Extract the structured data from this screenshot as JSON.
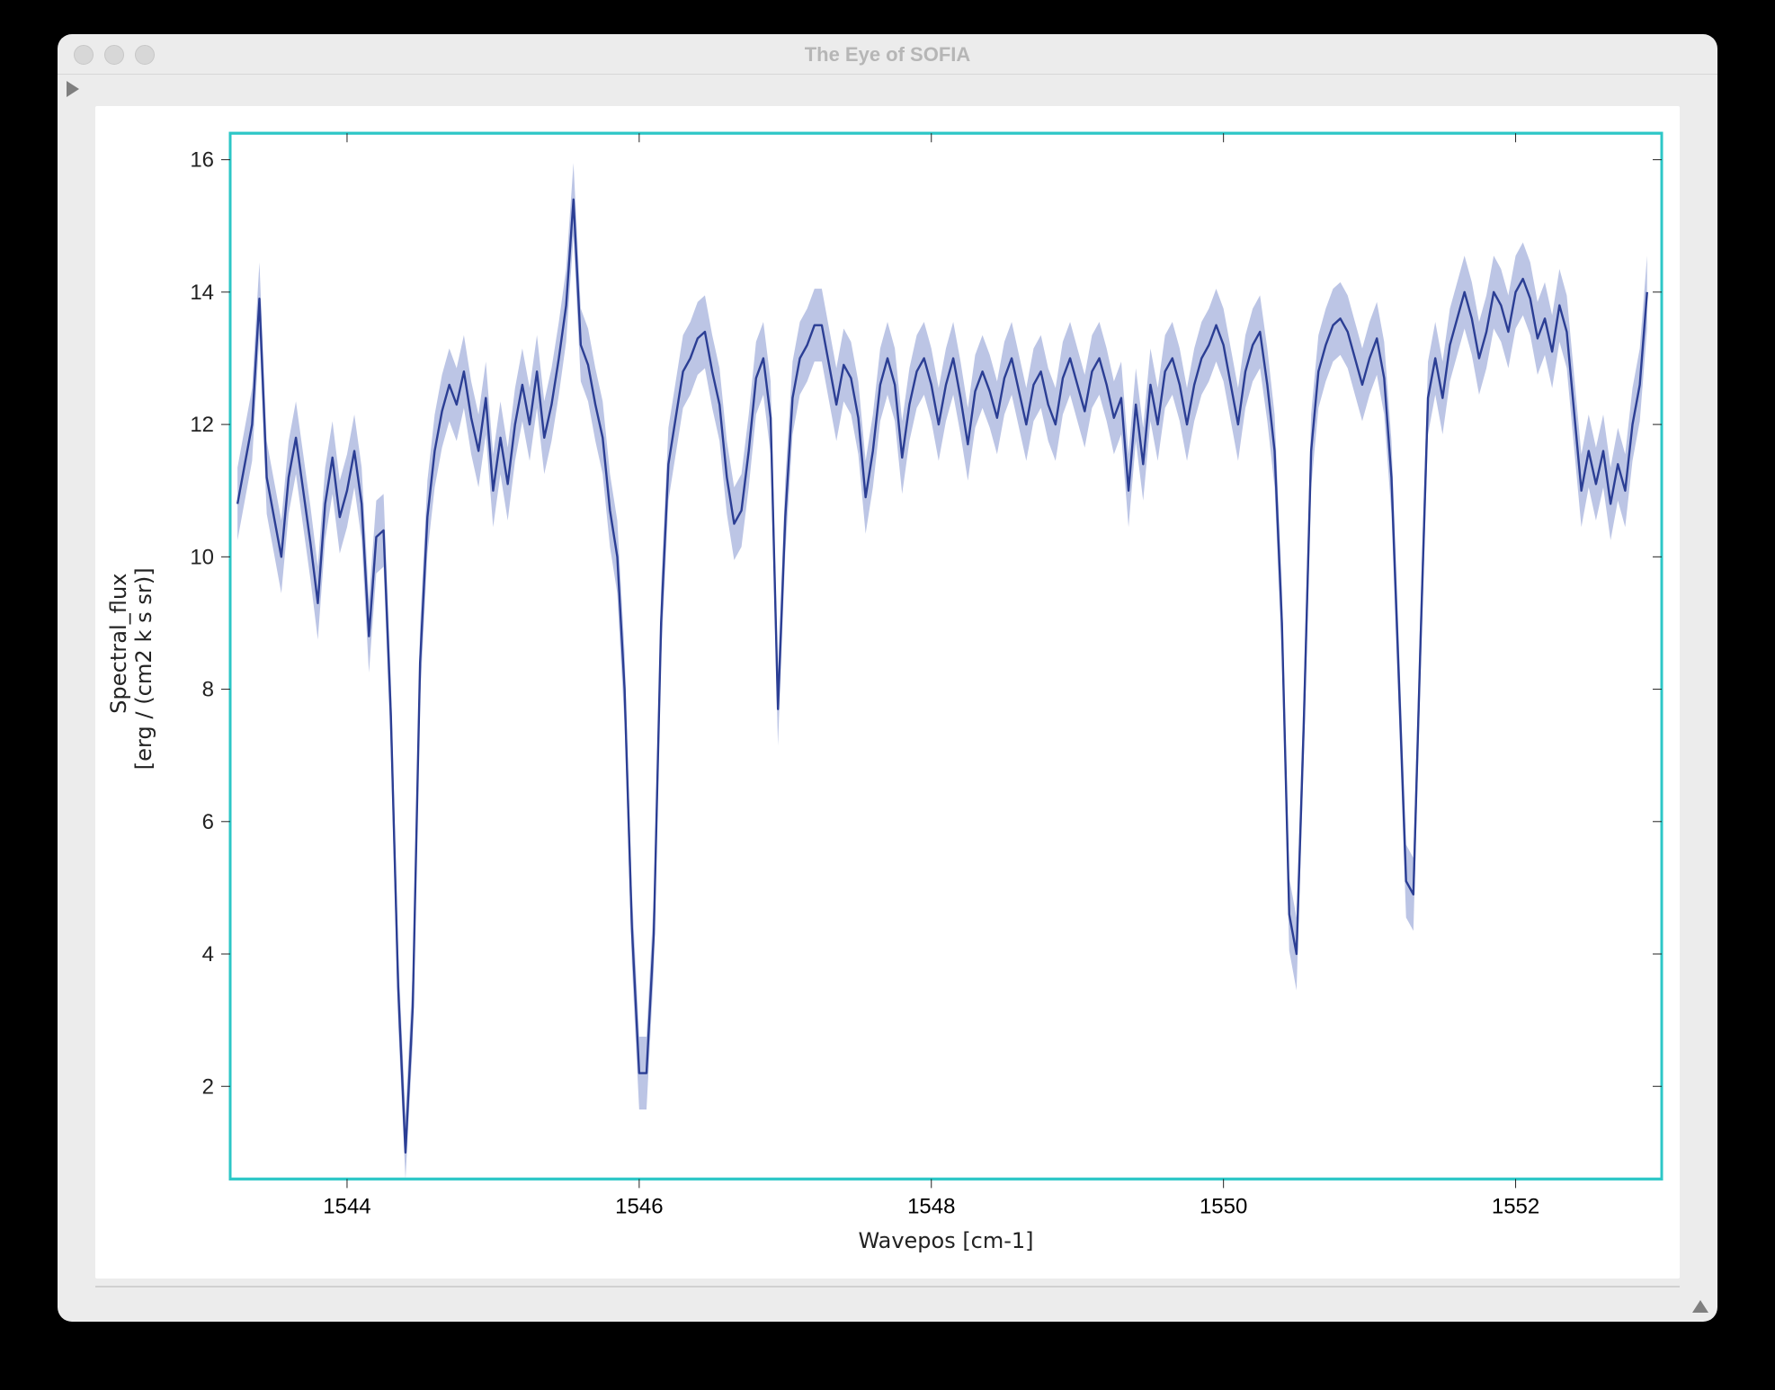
{
  "window": {
    "title": "The Eye of SOFIA"
  },
  "chart_data": {
    "type": "line",
    "title": "",
    "xlabel": "Wavepos [cm-1]",
    "ylabel_line1": "Spectral_flux",
    "ylabel_line2": "[erg / (cm2 k s sr)]",
    "xlim": [
      1543.2,
      1553.0
    ],
    "ylim": [
      0.6,
      16.4
    ],
    "xticks": [
      1544,
      1546,
      1548,
      1550,
      1552
    ],
    "yticks": [
      2,
      4,
      6,
      8,
      10,
      12,
      14,
      16
    ],
    "frame_color": "#2dc7c7",
    "series": [
      {
        "name": "spectrum",
        "color": "#2b3e94",
        "x": [
          1543.25,
          1543.3,
          1543.35,
          1543.4,
          1543.45,
          1543.5,
          1543.55,
          1543.6,
          1543.65,
          1543.7,
          1543.75,
          1543.8,
          1543.85,
          1543.9,
          1543.95,
          1544.0,
          1544.05,
          1544.1,
          1544.15,
          1544.2,
          1544.25,
          1544.3,
          1544.35,
          1544.4,
          1544.45,
          1544.5,
          1544.55,
          1544.6,
          1544.65,
          1544.7,
          1544.75,
          1544.8,
          1544.85,
          1544.9,
          1544.95,
          1545.0,
          1545.05,
          1545.1,
          1545.15,
          1545.2,
          1545.25,
          1545.3,
          1545.35,
          1545.4,
          1545.45,
          1545.5,
          1545.55,
          1545.6,
          1545.65,
          1545.7,
          1545.75,
          1545.8,
          1545.85,
          1545.9,
          1545.95,
          1546.0,
          1546.05,
          1546.1,
          1546.15,
          1546.2,
          1546.25,
          1546.3,
          1546.35,
          1546.4,
          1546.45,
          1546.5,
          1546.55,
          1546.6,
          1546.65,
          1546.7,
          1546.75,
          1546.8,
          1546.85,
          1546.9,
          1546.95,
          1547.0,
          1547.05,
          1547.1,
          1547.15,
          1547.2,
          1547.25,
          1547.3,
          1547.35,
          1547.4,
          1547.45,
          1547.5,
          1547.55,
          1547.6,
          1547.65,
          1547.7,
          1547.75,
          1547.8,
          1547.85,
          1547.9,
          1547.95,
          1548.0,
          1548.05,
          1548.1,
          1548.15,
          1548.2,
          1548.25,
          1548.3,
          1548.35,
          1548.4,
          1548.45,
          1548.5,
          1548.55,
          1548.6,
          1548.65,
          1548.7,
          1548.75,
          1548.8,
          1548.85,
          1548.9,
          1548.95,
          1549.0,
          1549.05,
          1549.1,
          1549.15,
          1549.2,
          1549.25,
          1549.3,
          1549.35,
          1549.4,
          1549.45,
          1549.5,
          1549.55,
          1549.6,
          1549.65,
          1549.7,
          1549.75,
          1549.8,
          1549.85,
          1549.9,
          1549.95,
          1550.0,
          1550.05,
          1550.1,
          1550.15,
          1550.2,
          1550.25,
          1550.3,
          1550.35,
          1550.4,
          1550.45,
          1550.5,
          1550.55,
          1550.6,
          1550.65,
          1550.7,
          1550.75,
          1550.8,
          1550.85,
          1550.9,
          1550.95,
          1551.0,
          1551.05,
          1551.1,
          1551.15,
          1551.2,
          1551.25,
          1551.3,
          1551.35,
          1551.4,
          1551.45,
          1551.5,
          1551.55,
          1551.6,
          1551.65,
          1551.7,
          1551.75,
          1551.8,
          1551.85,
          1551.9,
          1551.95,
          1552.0,
          1552.05,
          1552.1,
          1552.15,
          1552.2,
          1552.25,
          1552.3,
          1552.35,
          1552.4,
          1552.45,
          1552.5,
          1552.55,
          1552.6,
          1552.65,
          1552.7,
          1552.75,
          1552.8,
          1552.85,
          1552.9
        ],
        "y": [
          10.8,
          11.4,
          12.0,
          13.9,
          11.2,
          10.6,
          10.0,
          11.2,
          11.8,
          11.0,
          10.2,
          9.3,
          10.8,
          11.5,
          10.6,
          11.0,
          11.6,
          10.8,
          8.8,
          10.3,
          10.4,
          7.6,
          3.5,
          1.0,
          3.2,
          8.4,
          10.6,
          11.6,
          12.2,
          12.6,
          12.3,
          12.8,
          12.1,
          11.6,
          12.4,
          11.0,
          11.8,
          11.1,
          12.0,
          12.6,
          12.0,
          12.8,
          11.8,
          12.3,
          13.0,
          13.8,
          15.4,
          13.2,
          12.9,
          12.3,
          11.8,
          10.7,
          10.0,
          8.0,
          4.4,
          2.2,
          2.2,
          4.3,
          9.0,
          11.4,
          12.1,
          12.8,
          13.0,
          13.3,
          13.4,
          12.8,
          12.3,
          11.2,
          10.5,
          10.7,
          11.6,
          12.7,
          13.0,
          12.1,
          7.7,
          10.6,
          12.4,
          13.0,
          13.2,
          13.5,
          13.5,
          12.9,
          12.3,
          12.9,
          12.7,
          12.1,
          10.9,
          11.6,
          12.6,
          13.0,
          12.6,
          11.5,
          12.3,
          12.8,
          13.0,
          12.6,
          12.0,
          12.6,
          13.0,
          12.4,
          11.7,
          12.5,
          12.8,
          12.5,
          12.1,
          12.7,
          13.0,
          12.5,
          12.0,
          12.6,
          12.8,
          12.3,
          12.0,
          12.7,
          13.0,
          12.6,
          12.2,
          12.8,
          13.0,
          12.6,
          12.1,
          12.4,
          11.0,
          12.3,
          11.4,
          12.6,
          12.0,
          12.8,
          13.0,
          12.6,
          12.0,
          12.6,
          13.0,
          13.2,
          13.5,
          13.2,
          12.6,
          12.0,
          12.8,
          13.2,
          13.4,
          12.6,
          11.6,
          9.0,
          4.6,
          4.0,
          7.5,
          11.6,
          12.8,
          13.2,
          13.5,
          13.6,
          13.4,
          13.0,
          12.6,
          13.0,
          13.3,
          12.7,
          11.2,
          8.2,
          5.1,
          4.9,
          8.8,
          12.4,
          13.0,
          12.4,
          13.2,
          13.6,
          14.0,
          13.6,
          13.0,
          13.4,
          14.0,
          13.8,
          13.4,
          14.0,
          14.2,
          13.9,
          13.3,
          13.6,
          13.1,
          13.8,
          13.4,
          12.2,
          11.0,
          11.6,
          11.1,
          11.6,
          10.8,
          11.4,
          11.0,
          12.0,
          12.6,
          14.0
        ],
        "err": 0.55
      }
    ]
  }
}
